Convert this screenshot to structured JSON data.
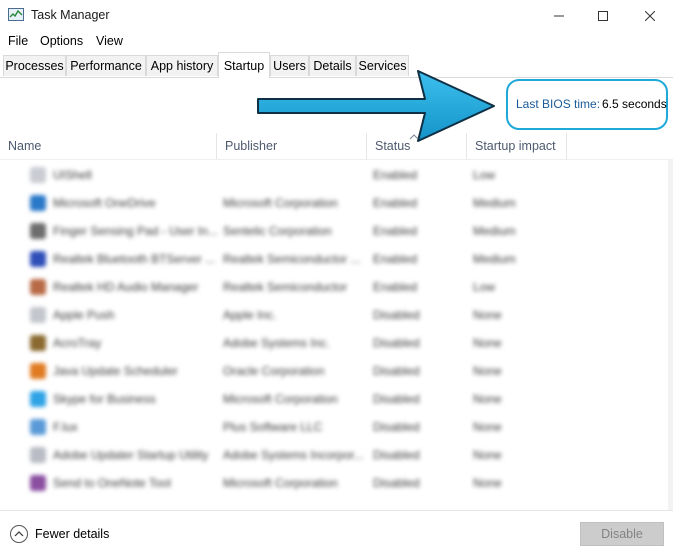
{
  "window": {
    "title": "Task Manager",
    "controls": [
      "minimize",
      "maximize",
      "close"
    ]
  },
  "menu": [
    "File",
    "Options",
    "View"
  ],
  "tabs": [
    {
      "label": "Processes",
      "active": false
    },
    {
      "label": "Performance",
      "active": false
    },
    {
      "label": "App history",
      "active": false
    },
    {
      "label": "Startup",
      "active": true
    },
    {
      "label": "Users",
      "active": false
    },
    {
      "label": "Details",
      "active": false
    },
    {
      "label": "Services",
      "active": false
    }
  ],
  "bios": {
    "label": "Last BIOS time:",
    "value": "6.5 seconds"
  },
  "columns": [
    "Name",
    "Publisher",
    "Status",
    "Startup impact"
  ],
  "rows": [
    {
      "name": "UIShell",
      "publisher": "",
      "status": "Enabled",
      "impact": "Low",
      "icon_color": "#c9ccd2"
    },
    {
      "name": "Microsoft OneDrive",
      "publisher": "Microsoft Corporation",
      "status": "Enabled",
      "impact": "Medium",
      "icon_color": "#2a78c8"
    },
    {
      "name": "Finger Sensing Pad - User In...",
      "publisher": "Sentelic Corporation",
      "status": "Enabled",
      "impact": "Medium",
      "icon_color": "#6d6d6d"
    },
    {
      "name": "Realtek Bluetooth BTServer ...",
      "publisher": "Realtek Semiconductor ...",
      "status": "Enabled",
      "impact": "Medium",
      "icon_color": "#2f4fb8"
    },
    {
      "name": "Realtek HD Audio Manager",
      "publisher": "Realtek Semiconductor",
      "status": "Enabled",
      "impact": "Low",
      "icon_color": "#b86a46"
    },
    {
      "name": "Apple Push",
      "publisher": "Apple Inc.",
      "status": "Disabled",
      "impact": "None",
      "icon_color": "#c3c6cc"
    },
    {
      "name": "AcroTray",
      "publisher": "Adobe Systems Inc.",
      "status": "Disabled",
      "impact": "None",
      "icon_color": "#8a6a30"
    },
    {
      "name": "Java Update Scheduler",
      "publisher": "Oracle Corporation",
      "status": "Disabled",
      "impact": "None",
      "icon_color": "#e07b22"
    },
    {
      "name": "Skype for Business",
      "publisher": "Microsoft Corporation",
      "status": "Disabled",
      "impact": "None",
      "icon_color": "#2fa3e6"
    },
    {
      "name": "F.lux",
      "publisher": "Plus Software LLC",
      "status": "Disabled",
      "impact": "None",
      "icon_color": "#5a9ad8"
    },
    {
      "name": "Adobe Updater Startup Utility",
      "publisher": "Adobe Systems Incorpor...",
      "status": "Disabled",
      "impact": "None",
      "icon_color": "#b9bcc4"
    },
    {
      "name": "Send to OneNote Tool",
      "publisher": "Microsoft Corporation",
      "status": "Disabled",
      "impact": "None",
      "icon_color": "#8a4fa0"
    }
  ],
  "footer": {
    "fewer_details": "Fewer details",
    "disable": "Disable"
  }
}
